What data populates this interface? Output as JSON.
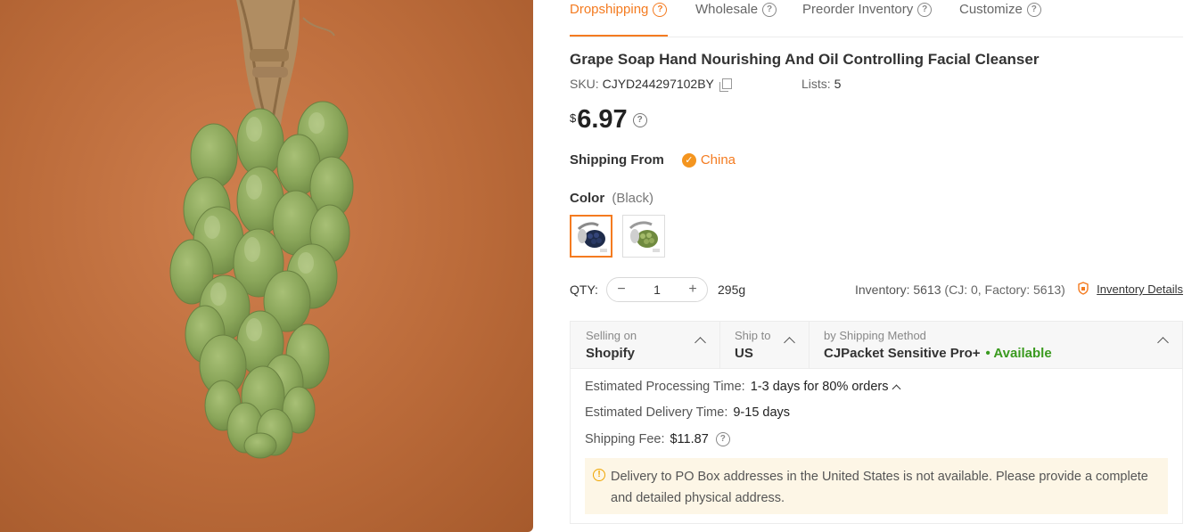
{
  "tabs": [
    {
      "label": "Dropshipping",
      "active": true
    },
    {
      "label": "Wholesale",
      "active": false
    },
    {
      "label": "Preorder Inventory",
      "active": false
    },
    {
      "label": "Customize",
      "active": false
    }
  ],
  "product": {
    "title": "Grape Soap Hand Nourishing And Oil Controlling Facial Cleanser",
    "sku_label": "SKU:",
    "sku": "CJYD244297102BY",
    "lists_label": "Lists:",
    "lists_count": "5",
    "currency": "$",
    "price": "6.97"
  },
  "shipping_from": {
    "label": "Shipping From",
    "value": "China"
  },
  "color": {
    "label": "Color",
    "selected": "(Black)",
    "variants": [
      "Black",
      "Green"
    ]
  },
  "quantity": {
    "label": "QTY:",
    "value": "1",
    "minus": "−",
    "plus": "+",
    "weight": "295g",
    "inventory_label": "Inventory:",
    "inventory": "5613",
    "inventory_breakdown": "(CJ: 0, Factory: 5613)",
    "details_link": "Inventory Details"
  },
  "shipping": {
    "selling_on_label": "Selling on",
    "selling_on": "Shopify",
    "ship_to_label": "Ship to",
    "ship_to": "US",
    "method_label": "by Shipping Method",
    "method": "CJPacket Sensitive Pro+",
    "availability": "• Available",
    "processing_label": "Estimated Processing Time:",
    "processing_value": "1-3 days for 80% orders",
    "delivery_label": "Estimated Delivery Time:",
    "delivery_value": "9-15 days",
    "fee_label": "Shipping Fee:",
    "fee_value": "$11.87",
    "notice": "Delivery to PO Box addresses in the United States is not available. Please provide a complete and detailed physical address."
  },
  "colors": {
    "accent": "#f47b20",
    "available": "#3a9a1f",
    "notice_bg": "#fdf6e6"
  },
  "icons": [
    "help-icon",
    "copy-icon",
    "check-circle-icon",
    "minus-icon",
    "plus-icon",
    "inventory-shield-icon",
    "chevron-up-icon",
    "warning-icon"
  ]
}
